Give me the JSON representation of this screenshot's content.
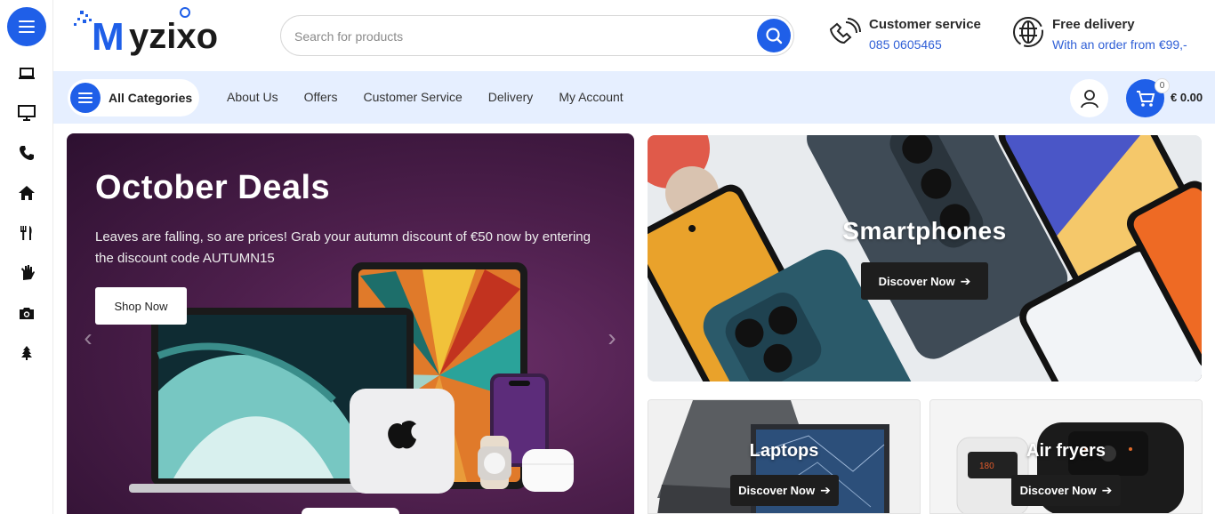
{
  "brand": {
    "logo_text": "Myzixo",
    "accent": "#1f5fe8"
  },
  "search": {
    "placeholder": "Search for products",
    "value": ""
  },
  "header_info": [
    {
      "title": "Customer service",
      "sub": "085 0605465",
      "icon": "customer-service-icon"
    },
    {
      "title": "Free delivery",
      "sub": "With an order from €99,-",
      "icon": "globe-icon"
    }
  ],
  "rail": {
    "icons": [
      "laptop-icon",
      "monitor-icon",
      "phone-icon",
      "home-icon",
      "cutlery-icon",
      "hand-icon",
      "camera-icon",
      "tree-icon"
    ]
  },
  "nav": {
    "all_categories": "All Categories",
    "links": [
      "About Us",
      "Offers",
      "Customer Service",
      "Delivery",
      "My Account"
    ]
  },
  "cart": {
    "count": "0",
    "total": "€ 0.00"
  },
  "hero": {
    "title": "October Deals",
    "text": "Leaves are falling, so are prices! Grab your autumn discount of €50 now by entering the discount code AUTUMN15",
    "button": "Shop Now"
  },
  "banners": {
    "smartphones": {
      "title": "Smartphones",
      "button": "Discover Now"
    },
    "laptops": {
      "title": "Laptops",
      "button": "Discover Now"
    },
    "airfryers": {
      "title": "Air fryers",
      "button": "Discover Now"
    }
  }
}
